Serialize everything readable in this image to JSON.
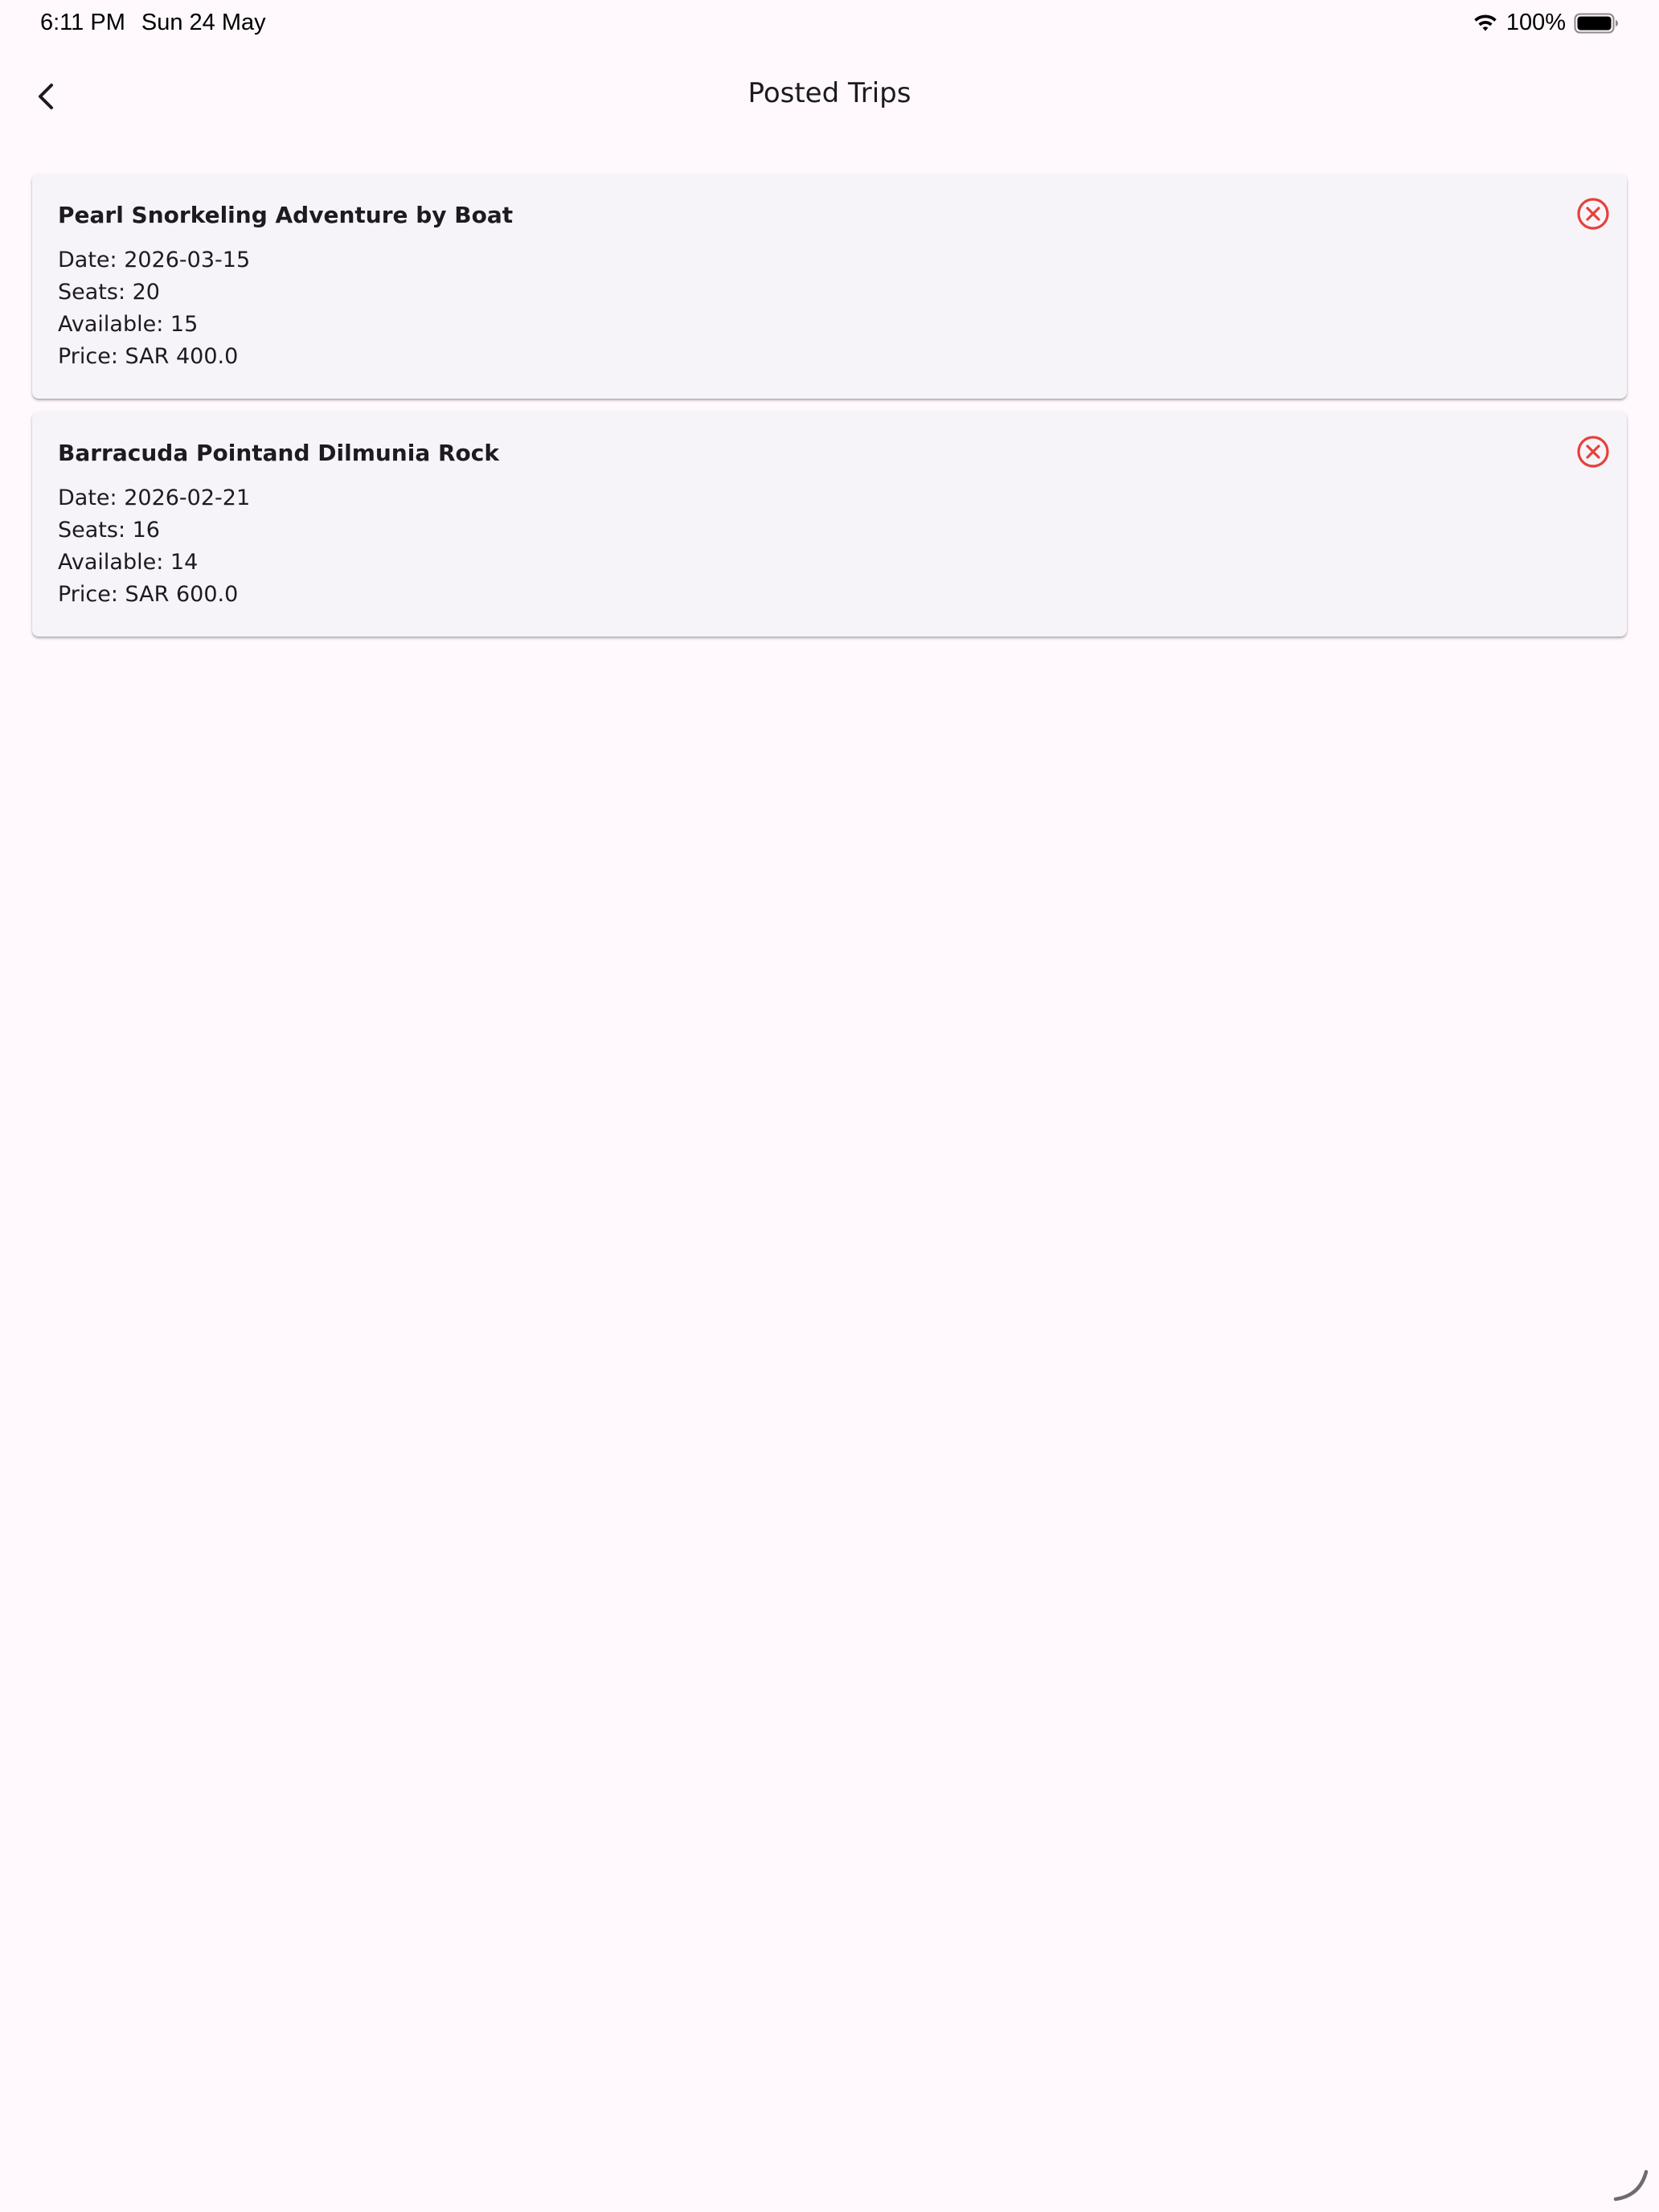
{
  "status_bar": {
    "time": "6:11 PM",
    "date": "Sun 24 May",
    "battery": "100%",
    "icons": [
      "wifi-icon",
      "battery-icon"
    ]
  },
  "app_bar": {
    "title": "Posted Trips",
    "back_icon": "chevron-left-icon"
  },
  "colors": {
    "background": "#fff8fd",
    "card": "#f6f4f8",
    "cancel_icon": "#e5413a",
    "text": "#1d1b20"
  },
  "trips": [
    {
      "title": "Pearl Snorkeling Adventure by Boat",
      "date": "Date: 2026-03-15",
      "seats": "Seats: 20",
      "available": "Available: 15",
      "price": "Price: SAR 400.0",
      "action_icon": "cancel-circle-icon"
    },
    {
      "title": "Barracuda Pointand Dilmunia Rock",
      "date": "Date: 2026-02-21",
      "seats": "Seats: 16",
      "available": "Available: 14",
      "price": "Price: SAR 600.0",
      "action_icon": "cancel-circle-icon"
    }
  ]
}
